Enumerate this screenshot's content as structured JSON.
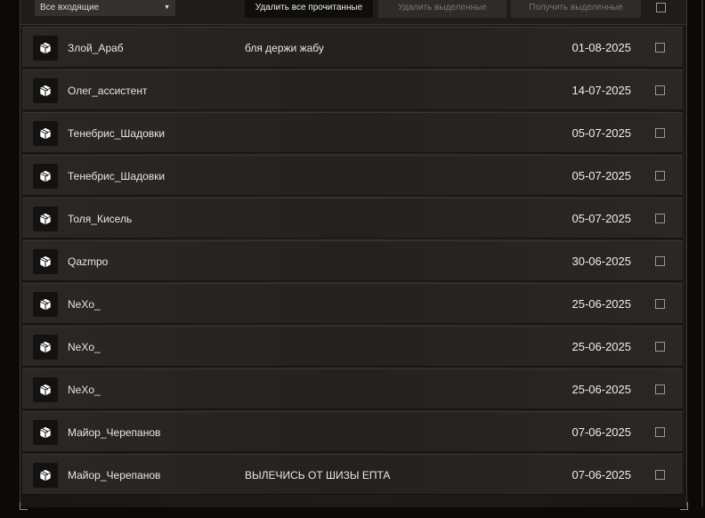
{
  "toolbar": {
    "filter_selected": "Все входящие",
    "delete_read_label": "Удалить все прочитанные",
    "delete_selected_label": "Удалить выделенные",
    "receive_selected_label": "Получить выделенные"
  },
  "messages": [
    {
      "sender": "Злой_Араб",
      "subject": "бля держи жабу",
      "date": "01-08-2025"
    },
    {
      "sender": "Олег_ассистент",
      "subject": "",
      "date": "14-07-2025"
    },
    {
      "sender": "Тенебрис_Шадовки",
      "subject": "",
      "date": "05-07-2025"
    },
    {
      "sender": "Тенебрис_Шадовки",
      "subject": "",
      "date": "05-07-2025"
    },
    {
      "sender": "Толя_Кисель",
      "subject": "",
      "date": "05-07-2025"
    },
    {
      "sender": "Qazmpo",
      "subject": "",
      "date": "30-06-2025"
    },
    {
      "sender": "NeXo_",
      "subject": "",
      "date": "25-06-2025"
    },
    {
      "sender": "NeXo_",
      "subject": "",
      "date": "25-06-2025"
    },
    {
      "sender": "NeXo_",
      "subject": "",
      "date": "25-06-2025"
    },
    {
      "sender": "Майор_Черепанов",
      "subject": "",
      "date": "07-06-2025"
    },
    {
      "sender": "Майор_Черепанов",
      "subject": "ВЫЛЕЧИСЬ ОТ ШИЗЫ ЕПТА",
      "date": "07-06-2025"
    }
  ],
  "icons": {
    "message": "package-icon",
    "dropdown": "triangle-down-icon"
  }
}
